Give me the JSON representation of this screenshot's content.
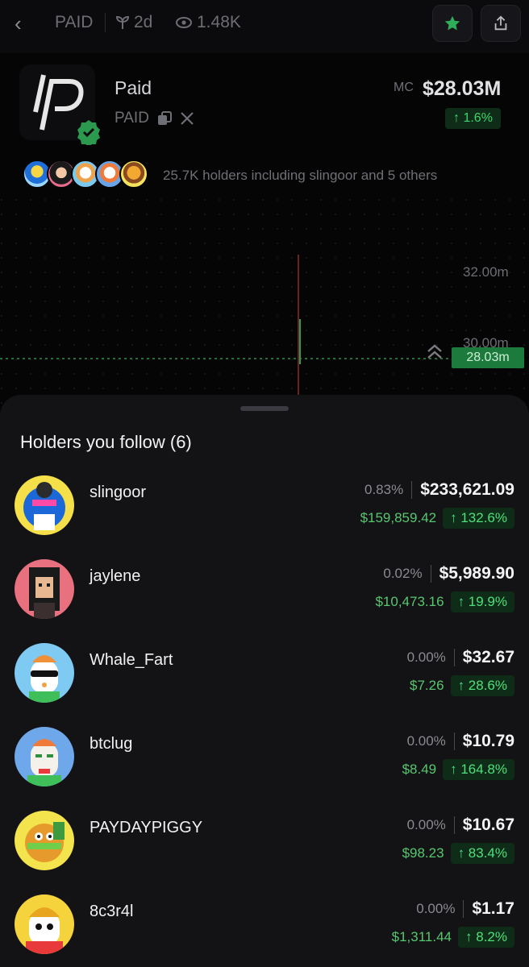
{
  "topbar": {
    "ticker": "PAID",
    "age": "2d",
    "views": "1.48K"
  },
  "token": {
    "name": "Paid",
    "ticker": "PAID",
    "mc_label": "MC",
    "mc_value": "$28.03M",
    "mc_change": "↑ 1.6%",
    "holders_text": "25.7K holders including slingoor and 5 others"
  },
  "chart": {
    "y_labels": [
      "32.00m",
      "30.00m"
    ],
    "current_price": "28.03m"
  },
  "colors": {
    "accent_green": "#3dd46a",
    "gain_bg": "#0f2c18",
    "sheet_bg": "#131316"
  },
  "sheet": {
    "title": "Holders you follow (6)"
  },
  "holders": [
    {
      "name": "slingoor",
      "pct": "0.83%",
      "value": "$233,621.09",
      "cost": "$159,859.42",
      "gain": "↑ 132.6%"
    },
    {
      "name": "jaylene",
      "pct": "0.02%",
      "value": "$5,989.90",
      "cost": "$10,473.16",
      "gain": "↑ 19.9%"
    },
    {
      "name": "Whale_Fart",
      "pct": "0.00%",
      "value": "$32.67",
      "cost": "$7.26",
      "gain": "↑ 28.6%"
    },
    {
      "name": "btclug",
      "pct": "0.00%",
      "value": "$10.79",
      "cost": "$8.49",
      "gain": "↑ 164.8%"
    },
    {
      "name": "PAYDAYPIGGY",
      "pct": "0.00%",
      "value": "$10.67",
      "cost": "$98.23",
      "gain": "↑ 83.4%"
    },
    {
      "name": "8c3r4l",
      "pct": "0.00%",
      "value": "$1.17",
      "cost": "$1,311.44",
      "gain": "↑ 8.2%"
    }
  ]
}
